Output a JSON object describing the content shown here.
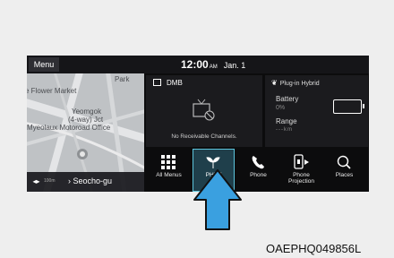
{
  "header": {
    "menu_label": "Menu",
    "time": "12:00",
    "ampm": "AM",
    "date": "Jan. 1"
  },
  "map": {
    "labels": [
      "Park",
      "e Flower Market",
      "Yeomgok",
      "(4-way) Jct",
      "Myeolaux Motoroad Office"
    ],
    "scale": "100m",
    "location": "Seocho-gu"
  },
  "dmb": {
    "title": "DMB",
    "message": "No Receivable Channels."
  },
  "phev": {
    "title": "Plug-in Hybrid",
    "battery_label": "Battery",
    "battery_value": "0%",
    "range_label": "Range",
    "range_value": "---km"
  },
  "dock": {
    "items": [
      {
        "label": "All Menus",
        "icon": "grid-icon"
      },
      {
        "label": "PHEV",
        "icon": "leaf-icon",
        "selected": true
      },
      {
        "label": "Phone",
        "icon": "phone-icon"
      },
      {
        "label": "Phone Projection",
        "icon": "phone-projection-icon"
      },
      {
        "label": "Places",
        "icon": "search-icon"
      }
    ]
  },
  "colors": {
    "selected_border": "#5cc4dc",
    "arrow_fill": "#3aa0e0"
  },
  "figure_code": "OAEPHQ049856L"
}
